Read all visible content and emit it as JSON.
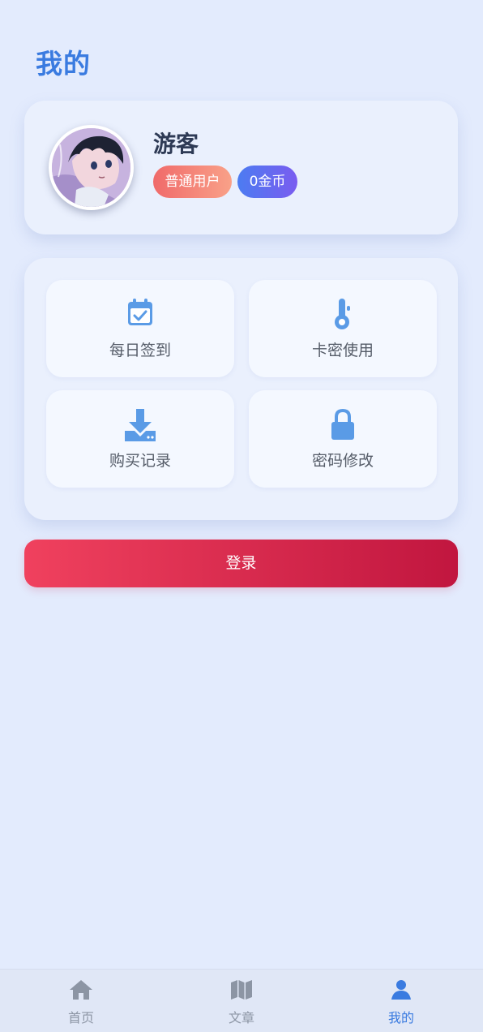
{
  "header": {
    "title": "我的"
  },
  "profile": {
    "username": "游客",
    "role_badge": "普通用户",
    "coins_badge": "0金币",
    "avatar_icon": "anime-avatar"
  },
  "menu": {
    "items": [
      {
        "label": "每日签到",
        "icon": "calendar-check-icon"
      },
      {
        "label": "卡密使用",
        "icon": "thermometer-icon"
      },
      {
        "label": "购买记录",
        "icon": "download-icon"
      },
      {
        "label": "密码修改",
        "icon": "lock-icon"
      }
    ]
  },
  "login_button": {
    "label": "登录"
  },
  "tabbar": {
    "items": [
      {
        "label": "首页",
        "icon": "home-icon"
      },
      {
        "label": "文章",
        "icon": "map-icon"
      },
      {
        "label": "我的",
        "icon": "user-icon",
        "active": true
      }
    ]
  },
  "colors": {
    "accent": "#3a7be0",
    "icon_blue": "#5a9be6",
    "login_start": "#f0415e",
    "login_end": "#c1163f",
    "role_badge_start": "#f06a6a",
    "coins_badge_start": "#4c7cf1"
  }
}
